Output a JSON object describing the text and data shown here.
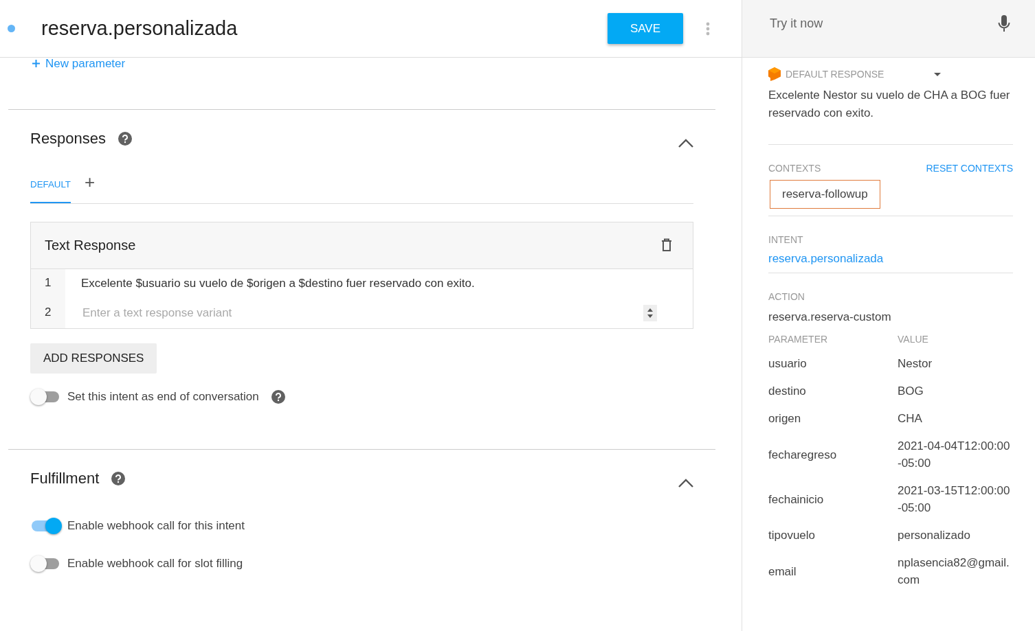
{
  "header": {
    "title": "reserva.personalizada",
    "save": "SAVE"
  },
  "new_parameter": "New parameter",
  "responses": {
    "title": "Responses",
    "tabs": [
      {
        "label": "DEFAULT",
        "selected": true
      }
    ],
    "add_tab": "+",
    "text_response": {
      "title": "Text Response",
      "lines": [
        {
          "number": "1",
          "value": "Excelente $usuario  su vuelo de $origen a $destino fuer reservado con exito."
        },
        {
          "number": "2",
          "placeholder": "Enter a text response variant"
        }
      ]
    },
    "add_button": "ADD RESPONSES",
    "end_toggle": {
      "label": "Set this intent as end of conversation",
      "on": false
    }
  },
  "fulfillment": {
    "title": "Fulfillment",
    "toggles": [
      {
        "label": "Enable webhook call for this intent",
        "on": true
      },
      {
        "label": "Enable webhook call for slot filling",
        "on": false
      }
    ]
  },
  "try_panel": {
    "placeholder": "Try it now",
    "response_label": "DEFAULT RESPONSE",
    "response_text": "Excelente Nestor su vuelo de CHA a BOG fuer reservado con exito.",
    "contexts_label": "CONTEXTS",
    "reset_contexts": "RESET CONTEXTS",
    "contexts": [
      "reserva-followup"
    ],
    "intent_label": "INTENT",
    "intent": "reserva.personalizada",
    "action_label": "ACTION",
    "action": "reserva.reserva-custom",
    "parameter_header": "PARAMETER",
    "value_header": "VALUE",
    "parameters": [
      {
        "name": "usuario",
        "value": "Nestor"
      },
      {
        "name": "destino",
        "value": "BOG"
      },
      {
        "name": "origen",
        "value": "CHA"
      },
      {
        "name": "fecharegreso",
        "value": "2021-04-04T12:00:00 -05:00"
      },
      {
        "name": "fechainicio",
        "value": "2021-03-15T12:00:00 -05:00"
      },
      {
        "name": "tipovuelo",
        "value": "personalizado"
      },
      {
        "name": "email",
        "value": "nplasencia82@gmail.com"
      }
    ]
  }
}
